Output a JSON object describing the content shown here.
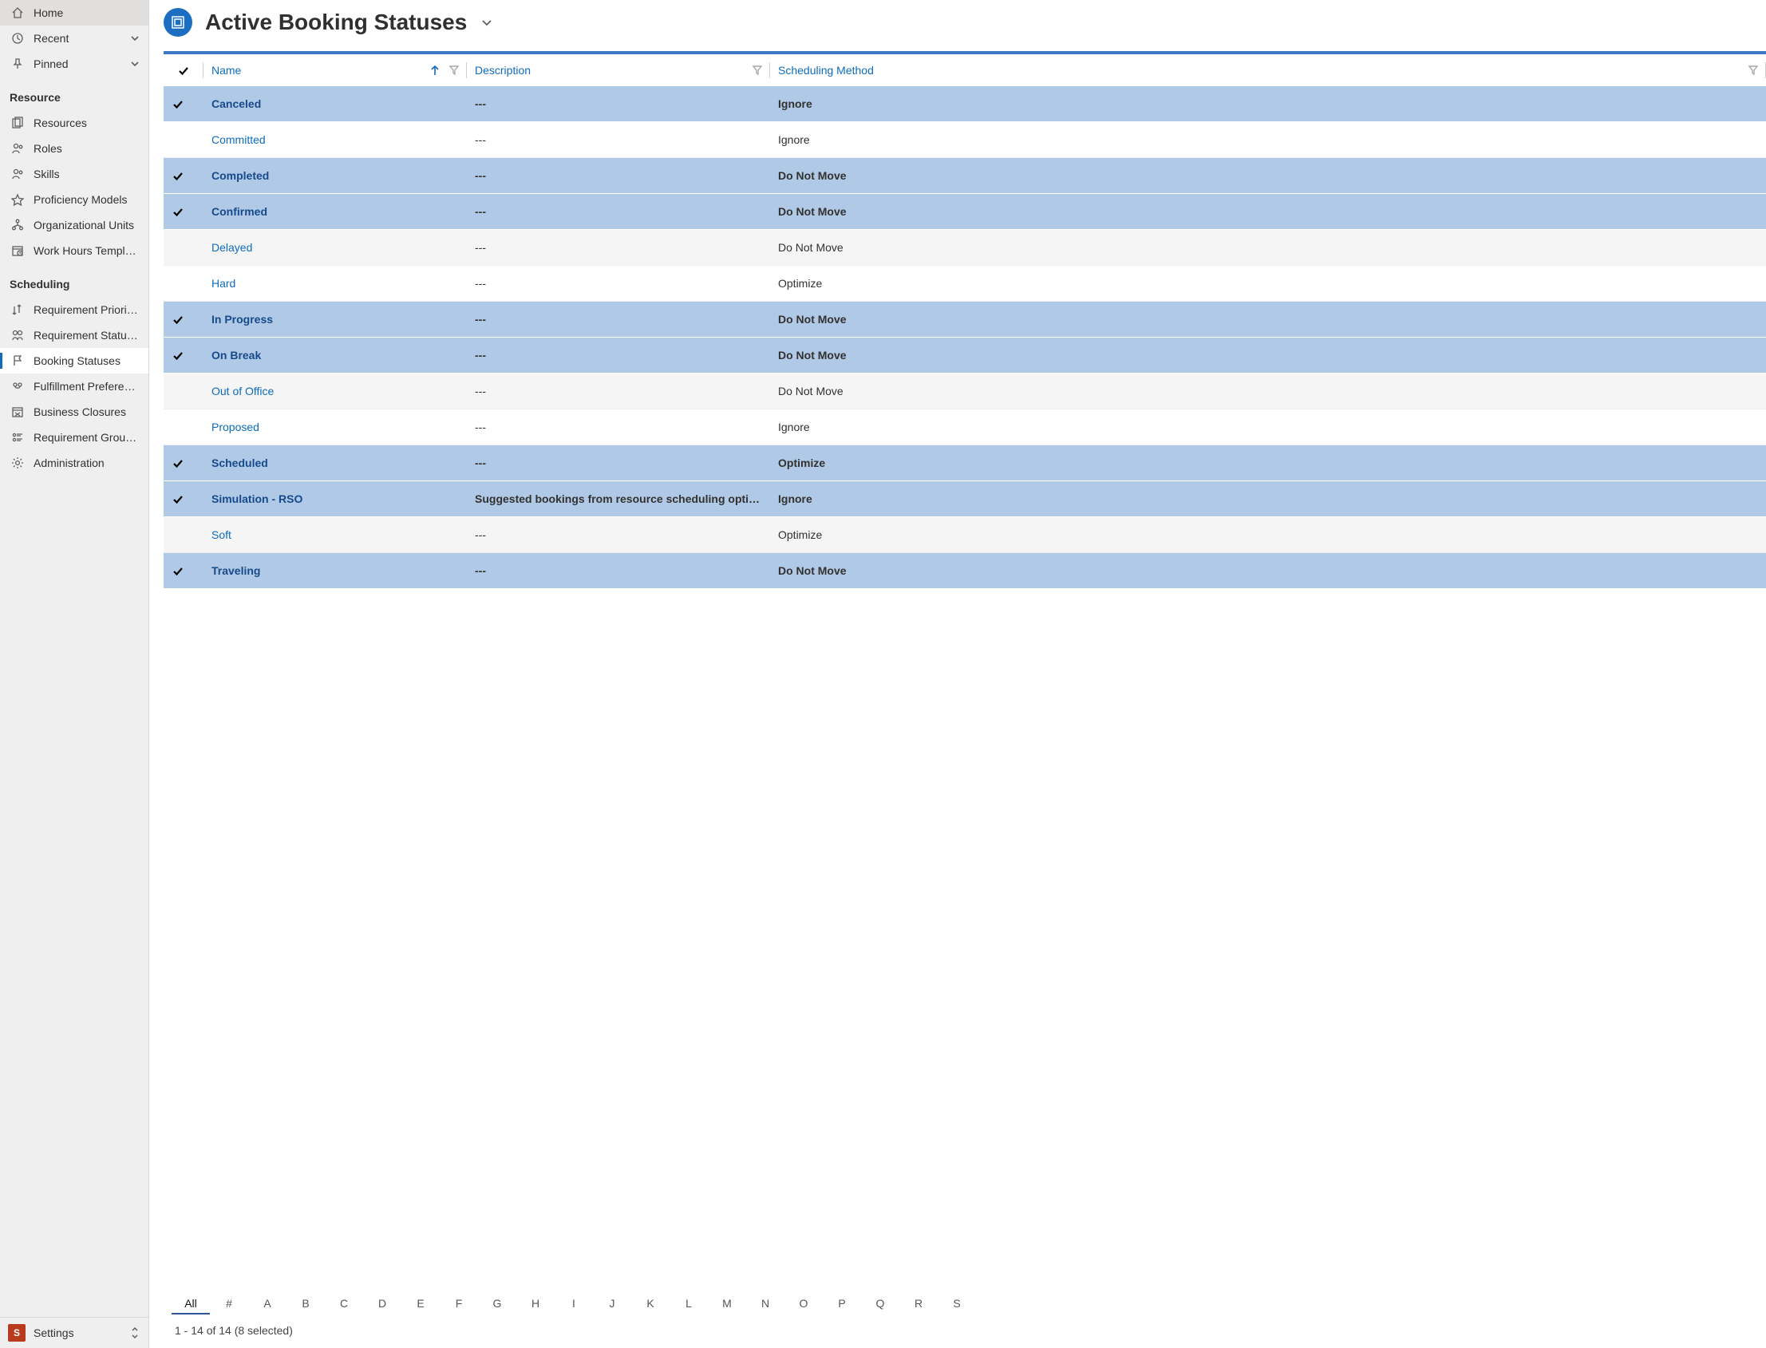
{
  "sidebar": {
    "top": [
      {
        "label": "Home",
        "icon": "home"
      },
      {
        "label": "Recent",
        "icon": "clock",
        "expandable": true
      },
      {
        "label": "Pinned",
        "icon": "pin",
        "expandable": true
      }
    ],
    "sections": [
      {
        "title": "Resource",
        "items": [
          {
            "label": "Resources",
            "icon": "resources"
          },
          {
            "label": "Roles",
            "icon": "roles"
          },
          {
            "label": "Skills",
            "icon": "roles"
          },
          {
            "label": "Proficiency Models",
            "icon": "star"
          },
          {
            "label": "Organizational Units",
            "icon": "org"
          },
          {
            "label": "Work Hours Templates",
            "icon": "work-hours"
          }
        ]
      },
      {
        "title": "Scheduling",
        "items": [
          {
            "label": "Requirement Priorities",
            "icon": "priority"
          },
          {
            "label": "Requirement Statuses",
            "icon": "req-status"
          },
          {
            "label": "Booking Statuses",
            "icon": "flag",
            "active": true
          },
          {
            "label": "Fulfillment Preferences",
            "icon": "fulfill"
          },
          {
            "label": "Business Closures",
            "icon": "closure"
          },
          {
            "label": "Requirement Group ...",
            "icon": "req-group"
          },
          {
            "label": "Administration",
            "icon": "gear"
          }
        ]
      }
    ],
    "footer": {
      "badge": "S",
      "label": "Settings"
    }
  },
  "header": {
    "view_name": "Active Booking Statuses"
  },
  "grid": {
    "columns": {
      "name": "Name",
      "description": "Description",
      "scheduling": "Scheduling Method"
    },
    "rows": [
      {
        "selected": true,
        "name": "Canceled",
        "description": "---",
        "scheduling": "Ignore"
      },
      {
        "selected": false,
        "name": "Committed",
        "description": "---",
        "scheduling": "Ignore"
      },
      {
        "selected": true,
        "name": "Completed",
        "description": "---",
        "scheduling": "Do Not Move"
      },
      {
        "selected": true,
        "name": "Confirmed",
        "description": "---",
        "scheduling": "Do Not Move"
      },
      {
        "selected": false,
        "alt": true,
        "name": "Delayed",
        "description": "---",
        "scheduling": "Do Not Move"
      },
      {
        "selected": false,
        "name": "Hard",
        "description": "---",
        "scheduling": "Optimize"
      },
      {
        "selected": true,
        "name": "In Progress",
        "description": "---",
        "scheduling": "Do Not Move"
      },
      {
        "selected": true,
        "name": "On Break",
        "description": "---",
        "scheduling": "Do Not Move"
      },
      {
        "selected": false,
        "alt": true,
        "name": "Out of Office",
        "description": "---",
        "scheduling": "Do Not Move"
      },
      {
        "selected": false,
        "name": "Proposed",
        "description": "---",
        "scheduling": "Ignore"
      },
      {
        "selected": true,
        "name": "Scheduled",
        "description": "---",
        "scheduling": "Optimize"
      },
      {
        "selected": true,
        "name": "Simulation - RSO",
        "description": "Suggested bookings from resource scheduling optimiz…",
        "scheduling": "Ignore"
      },
      {
        "selected": false,
        "alt": true,
        "name": "Soft",
        "description": "---",
        "scheduling": "Optimize"
      },
      {
        "selected": true,
        "name": "Traveling",
        "description": "---",
        "scheduling": "Do Not Move"
      }
    ],
    "jumpbar": [
      "All",
      "#",
      "A",
      "B",
      "C",
      "D",
      "E",
      "F",
      "G",
      "H",
      "I",
      "J",
      "K",
      "L",
      "M",
      "N",
      "O",
      "P",
      "Q",
      "R",
      "S"
    ],
    "jumpbar_active": "All",
    "status": "1 - 14 of 14 (8 selected)"
  }
}
